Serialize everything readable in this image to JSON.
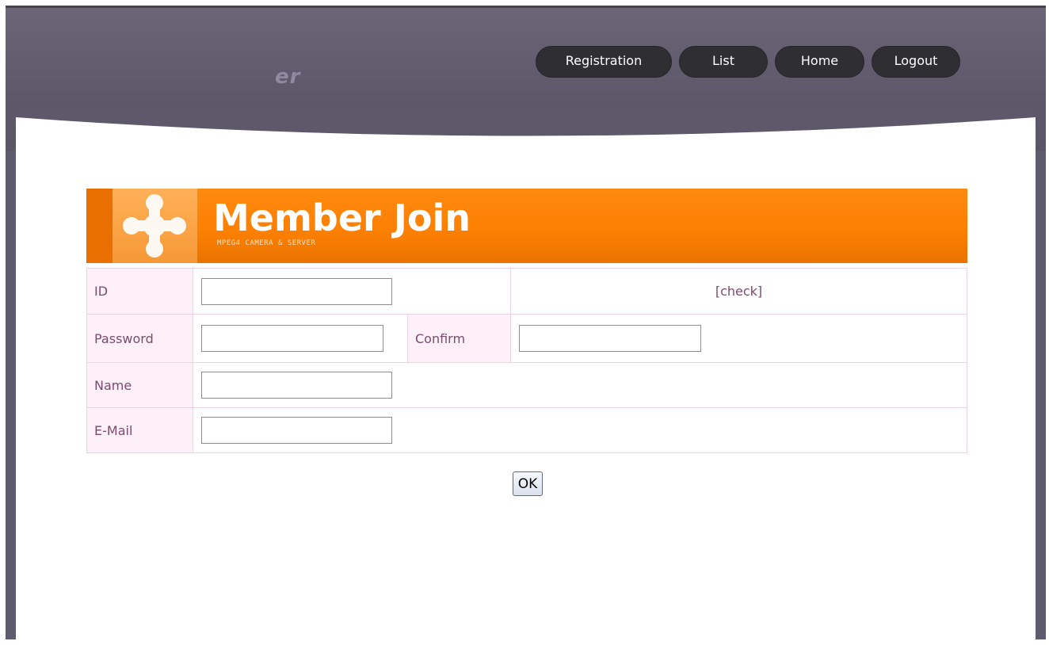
{
  "header": {
    "logo_text": "er",
    "nav": [
      "Registration",
      "List",
      "Home",
      "Logout"
    ]
  },
  "banner": {
    "title": "Member Join",
    "subtitle": "MPEG4 CAMERA & SERVER"
  },
  "form": {
    "id_label": "ID",
    "check_link": "[check]",
    "password_label": "Password",
    "confirm_label": "Confirm",
    "name_label": "Name",
    "email_label": "E-Mail",
    "ok_label": "OK"
  },
  "colors": {
    "frame": "#5f5b6e",
    "nav_button": "#2f2e32",
    "banner": "#fb7f02",
    "label_bg": "#fdf0f8",
    "label_text": "#7b4a6e"
  }
}
